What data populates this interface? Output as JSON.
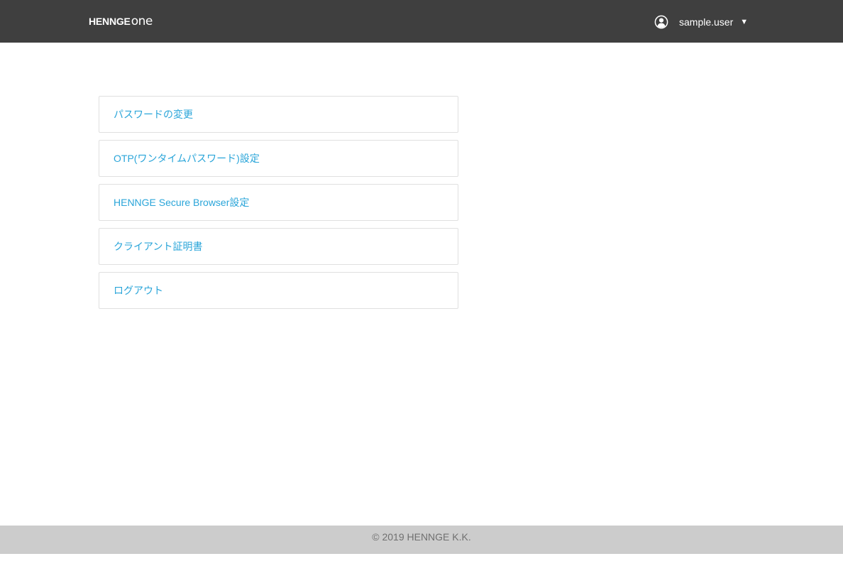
{
  "header": {
    "logo_main": "HENNGE",
    "logo_sub": "one",
    "user_icon": "user-circle-icon",
    "username": "sample.user",
    "caret_icon": "caret-down-icon",
    "caret_glyph": "▼"
  },
  "menu": {
    "items": [
      {
        "label": "パスワードの変更"
      },
      {
        "label": "OTP(ワンタイムパスワード)設定"
      },
      {
        "label": "HENNGE Secure Browser設定"
      },
      {
        "label": "クライアント証明書"
      },
      {
        "label": "ログアウト"
      }
    ]
  },
  "footer": {
    "copyright": "© 2019 HENNGE K.K."
  },
  "colors": {
    "header_bg": "#3f3f3f",
    "link": "#2aa5d9",
    "footer_bg": "#cccccc",
    "footer_text": "#707070",
    "item_border": "#e0e0e0"
  }
}
